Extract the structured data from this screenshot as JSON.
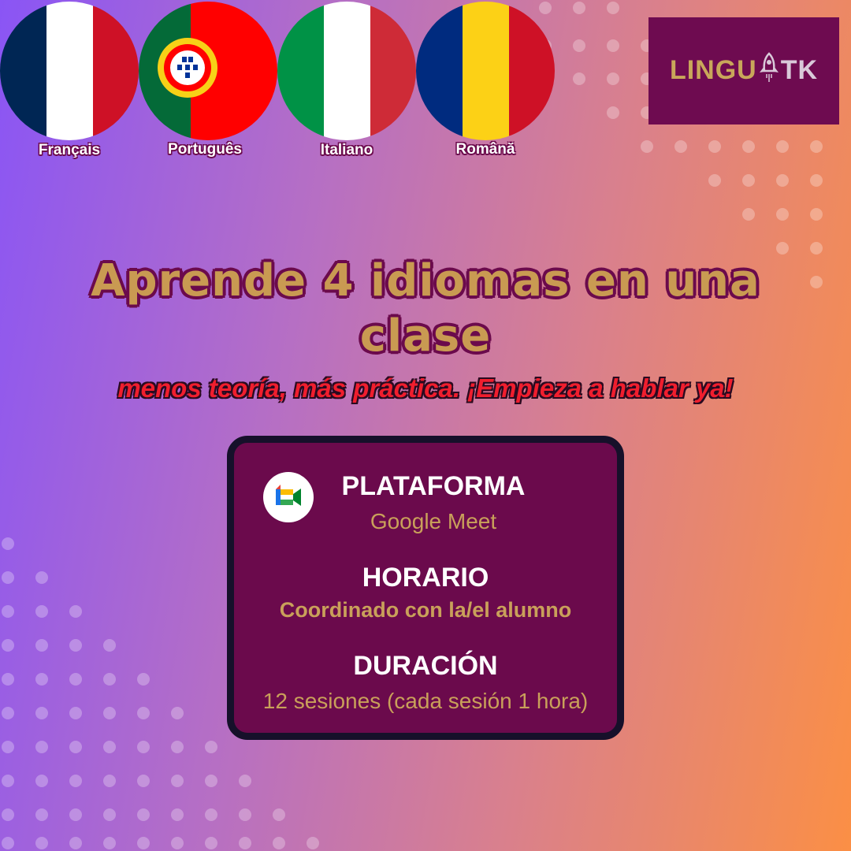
{
  "flags": [
    {
      "label": "Français",
      "icon": "france-flag-icon"
    },
    {
      "label": "Português",
      "icon": "portugal-flag-icon"
    },
    {
      "label": "Italiano",
      "icon": "italy-flag-icon"
    },
    {
      "label": "Română",
      "icon": "romania-flag-icon"
    }
  ],
  "logo": {
    "text_main": "LINGU",
    "text_end": "TK",
    "icon": "rocket-icon"
  },
  "headline": "Aprende 4 idiomas en una clase",
  "subheadline": "menos teoría, más práctica. ¡Empieza a hablar ya!",
  "card": {
    "platform_title": "PLATAFORMA",
    "platform_value": "Google Meet",
    "platform_icon": "google-meet-icon",
    "schedule_title": "HORARIO",
    "schedule_value": "Coordinado con la/el alumno",
    "duration_title": "DURACIÓN",
    "duration_value": "12 sesiones (cada sesión 1 hora)"
  },
  "colors": {
    "brand_purple": "#6b0a4c",
    "gold": "#c99a52",
    "accent_red": "#f01e2e",
    "gradient_start": "#8a55f5",
    "gradient_end": "#fb8f45"
  }
}
